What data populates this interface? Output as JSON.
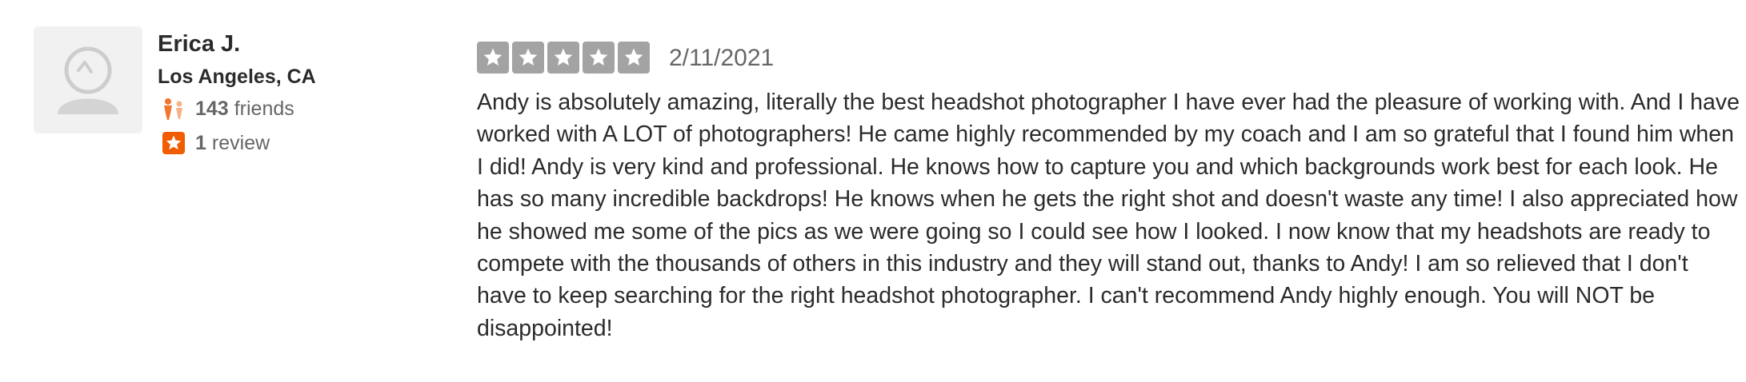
{
  "user": {
    "name": "Erica J.",
    "location": "Los Angeles, CA",
    "friends_count": "143",
    "friends_label": "friends",
    "reviews_count": "1",
    "reviews_label": "review"
  },
  "review": {
    "rating": 5,
    "date": "2/11/2021",
    "text": "Andy is absolutely amazing, literally the best headshot photographer I have ever had the pleasure of working with. And I have worked with A LOT of photographers! He came highly recommended by my coach and I am so grateful that I found him when I did! Andy is very kind and professional. He knows how to capture you and which backgrounds work best for each look. He has so many incredible backdrops! He knows when he gets the right shot and doesn't waste any time! I also appreciated how he showed me some of the pics as we were going so I could see how I looked. I now know that my headshots are ready to compete with the thousands of others in this industry and they will stand out, thanks to Andy! I am so relieved that I don't have to keep searching for the right headshot photographer. I can't recommend Andy highly enough. You will NOT be disappointed!"
  },
  "colors": {
    "star_fill": "#a3a3a3",
    "friends_icon": "#f1762d",
    "review_badge": "#f15c00",
    "text_primary": "#2b2b2b",
    "text_secondary": "#666666"
  },
  "icons": {
    "avatar": "default-user-avatar-icon",
    "friends": "friends-icon",
    "reviews": "review-star-badge-icon",
    "star": "star-icon"
  }
}
